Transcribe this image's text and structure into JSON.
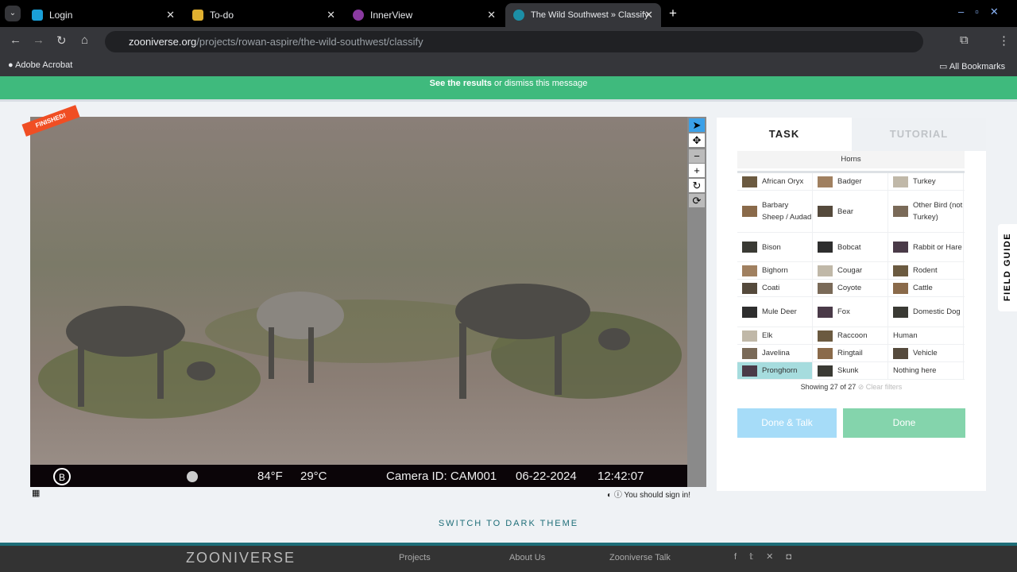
{
  "browser": {
    "tabs": [
      {
        "label": "Login",
        "color": "#1a9fd8"
      },
      {
        "label": "To-do",
        "color": "#e0b030"
      },
      {
        "label": "InnerView",
        "color": "#8a3aa0"
      },
      {
        "label": "The Wild Southwest » Classify",
        "color": "#1c8fa6"
      }
    ],
    "url_domain": "zooniverse.org",
    "url_path": "/projects/rowan-aspire/the-wild-southwest/classify",
    "bookmark": "Adobe Acrobat",
    "all_bookmarks": "All Bookmarks"
  },
  "banner": {
    "link": "See the results",
    "mid": " or ",
    "dismiss": "dismiss this message"
  },
  "subject": {
    "badge": "FINISHED!",
    "overlay": {
      "temp_f": "84°F",
      "temp_c": "29°C",
      "camera": "Camera ID: CAM001",
      "date": "06-22-2024",
      "time": "12:42:07",
      "logo": "B"
    }
  },
  "below_image": {
    "sign_in": "You should sign in!"
  },
  "panel": {
    "tab_task": "TASK",
    "tab_tutorial": "TUTORIAL",
    "filter": "Horns",
    "species": [
      [
        "African Oryx",
        "Badger",
        "Turkey"
      ],
      [
        "Barbary Sheep / Audad",
        "Bear",
        "Other Bird (not Turkey)"
      ],
      [
        "Bison",
        "Bobcat",
        "Rabbit or Hare"
      ],
      [
        "Bighorn",
        "Cougar",
        "Rodent"
      ],
      [
        "Coati",
        "Coyote",
        "Cattle"
      ],
      [
        "Mule Deer",
        "Fox",
        "Domestic Dog"
      ],
      [
        "Elk",
        "Raccoon",
        "Human"
      ],
      [
        "Javelina",
        "Ringtail",
        "Vehicle"
      ],
      [
        "Pronghorn",
        "Skunk",
        "Nothing here"
      ]
    ],
    "selected": "Pronghorn",
    "showing": "Showing 27 of 27",
    "clear": "Clear filters",
    "done_talk": "Done & Talk",
    "done": "Done"
  },
  "field_guide": "FIELD GUIDE",
  "theme_toggle": "SWITCH TO DARK THEME",
  "footer": {
    "logo": "ZOONIVERSE",
    "links": [
      "Projects",
      "About Us",
      "Zooniverse Talk"
    ]
  }
}
